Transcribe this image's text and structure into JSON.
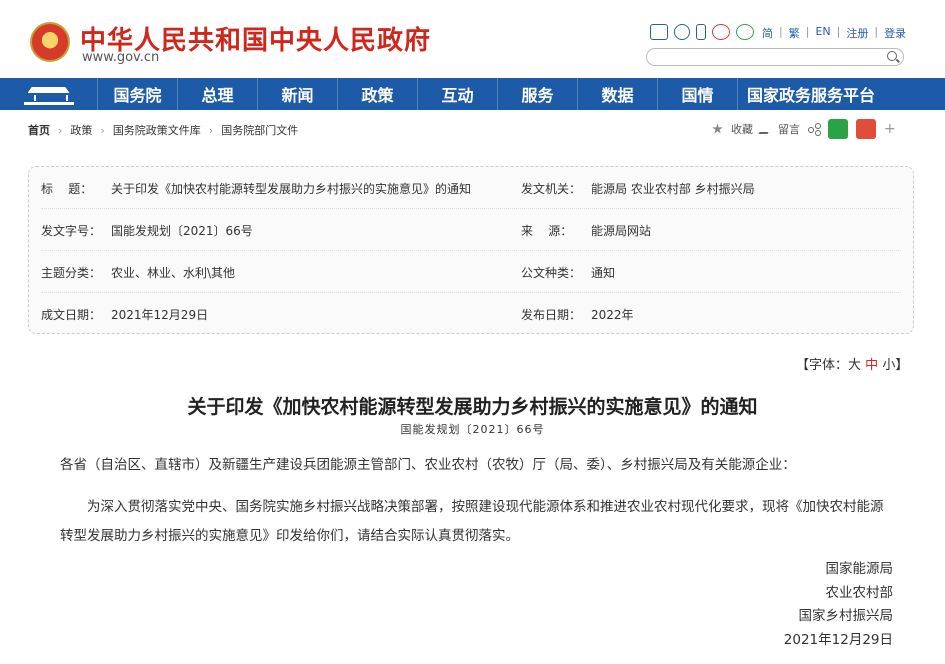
{
  "site": {
    "title": "中华人民共和国中央人民政府",
    "url": "www.gov.cn",
    "top_links": [
      "简",
      "繁",
      "EN",
      "注册",
      "登录"
    ]
  },
  "nav": [
    "国务院",
    "总理",
    "新闻",
    "政策",
    "互动",
    "服务",
    "数据",
    "国情",
    "国家政务服务平台"
  ],
  "breadcrumb": [
    "首页",
    "政策",
    "国务院政策文件库",
    "国务院部门文件"
  ],
  "tools": {
    "fav": "收藏",
    "comment": "留言"
  },
  "info": {
    "title_label": "标    题：",
    "title_value": "关于印发《加快农村能源转型发展助力乡村振兴的实施意见》的通知",
    "issuer_label": "发文机关：",
    "issuer_value": "能源局 农业农村部 乡村振兴局",
    "docno_label": "发文字号：",
    "docno_value": "国能发规划〔2021〕66号",
    "source_label": "来    源：",
    "source_value": "能源局网站",
    "topic_label": "主题分类：",
    "topic_value": "农业、林业、水利\\其他",
    "type_label": "公文种类：",
    "type_value": "通知",
    "written_label": "成文日期：",
    "written_value": "2021年12月29日",
    "published_label": "发布日期：",
    "published_value": "2022年"
  },
  "fontsize": {
    "prefix": "【字体：",
    "large": "大",
    "medium": "中",
    "small": "小",
    "suffix": "】"
  },
  "article": {
    "title": "关于印发《加快农村能源转型发展助力乡村振兴的实施意见》的通知",
    "doc_no": "国能发规划〔2021〕66号",
    "p1": "各省（自治区、直辖市）及新疆生产建设兵团能源主管部门、农业农村（农牧）厅（局、委）、乡村振兴局及有关能源企业：",
    "p2": "为深入贯彻落实党中央、国务院实施乡村振兴战略决策部署，按照建设现代能源体系和推进农业农村现代化要求，现将《加快农村能源转型发展助力乡村振兴的实施意见》印发给你们，请结合实际认真贯彻落实。",
    "signatures": [
      "国家能源局",
      "农业农村部",
      "国家乡村振兴局",
      "2021年12月29日"
    ]
  },
  "colors": {
    "brand_red": "#d0271c",
    "nav_blue": "#1d5aa8"
  }
}
